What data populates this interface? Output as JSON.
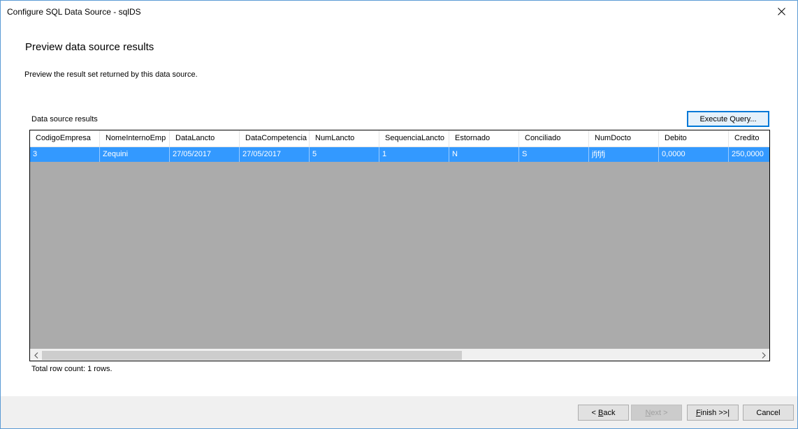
{
  "window": {
    "title": "Configure SQL Data Source - sqlDS"
  },
  "page": {
    "heading": "Preview data source results",
    "subheading": "Preview the result set returned by this data source.",
    "results_label": "Data source results",
    "execute_query_label": "Execute Query...",
    "row_count_text": "Total row count: 1 rows."
  },
  "grid": {
    "columns": [
      "CodigoEmpresa",
      "NomeInternoEmp",
      "DataLancto",
      "DataCompetencia",
      "NumLancto",
      "SequenciaLancto",
      "Estornado",
      "Conciliado",
      "NumDocto",
      "Debito",
      "Credito"
    ],
    "rows": [
      [
        "3",
        "Zequini",
        "27/05/2017",
        "27/05/2017",
        "5",
        "1",
        "N",
        "S",
        "jfjfjfj",
        "0,0000",
        "250,0000"
      ]
    ]
  },
  "footer": {
    "back_label": "< Back",
    "next_label": "Next >",
    "finish_label": "Finish >>|",
    "cancel_label": "Cancel"
  },
  "colors": {
    "selection": "#3399ff",
    "grid_background": "#ababab",
    "focus_border": "#0078d7"
  },
  "icons": {
    "close": "close-icon",
    "scroll_left": "chevron-left-icon",
    "scroll_right": "chevron-right-icon"
  }
}
